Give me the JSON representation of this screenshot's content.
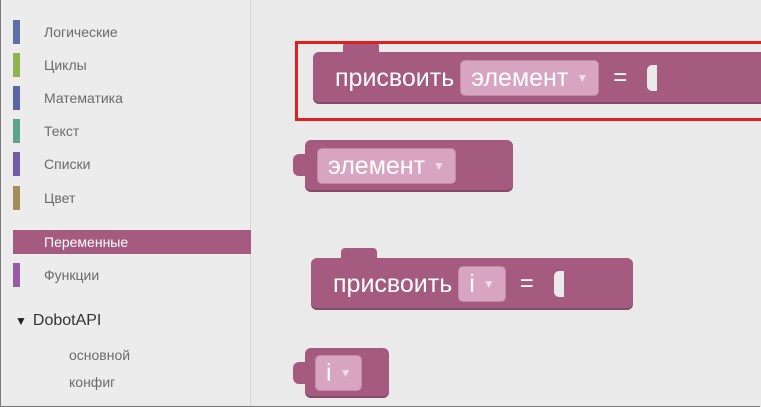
{
  "toolbox": {
    "categories": [
      {
        "label": "Логические",
        "color": "#5c6fa6"
      },
      {
        "label": "Циклы",
        "color": "#8fb34e"
      },
      {
        "label": "Математика",
        "color": "#5b67a5"
      },
      {
        "label": "Текст",
        "color": "#5ba58c"
      },
      {
        "label": "Списки",
        "color": "#745ba5"
      },
      {
        "label": "Цвет",
        "color": "#a58d5b"
      },
      {
        "label": "Переменные",
        "color": "#a55b80"
      },
      {
        "label": "Функции",
        "color": "#995ba5"
      }
    ],
    "dobot": {
      "label": "DobotAPI",
      "sub": [
        "основной",
        "конфиг"
      ]
    }
  },
  "workspace": {
    "block1": {
      "label": "присвоить",
      "field": "элемент",
      "eq": "="
    },
    "block2": {
      "field": "элемент"
    },
    "block3": {
      "label": "присвоить",
      "field": "i",
      "eq": "="
    },
    "block4": {
      "field": "i"
    }
  },
  "colors": {
    "variables": "#a55b80",
    "highlight": "#e0201f"
  }
}
